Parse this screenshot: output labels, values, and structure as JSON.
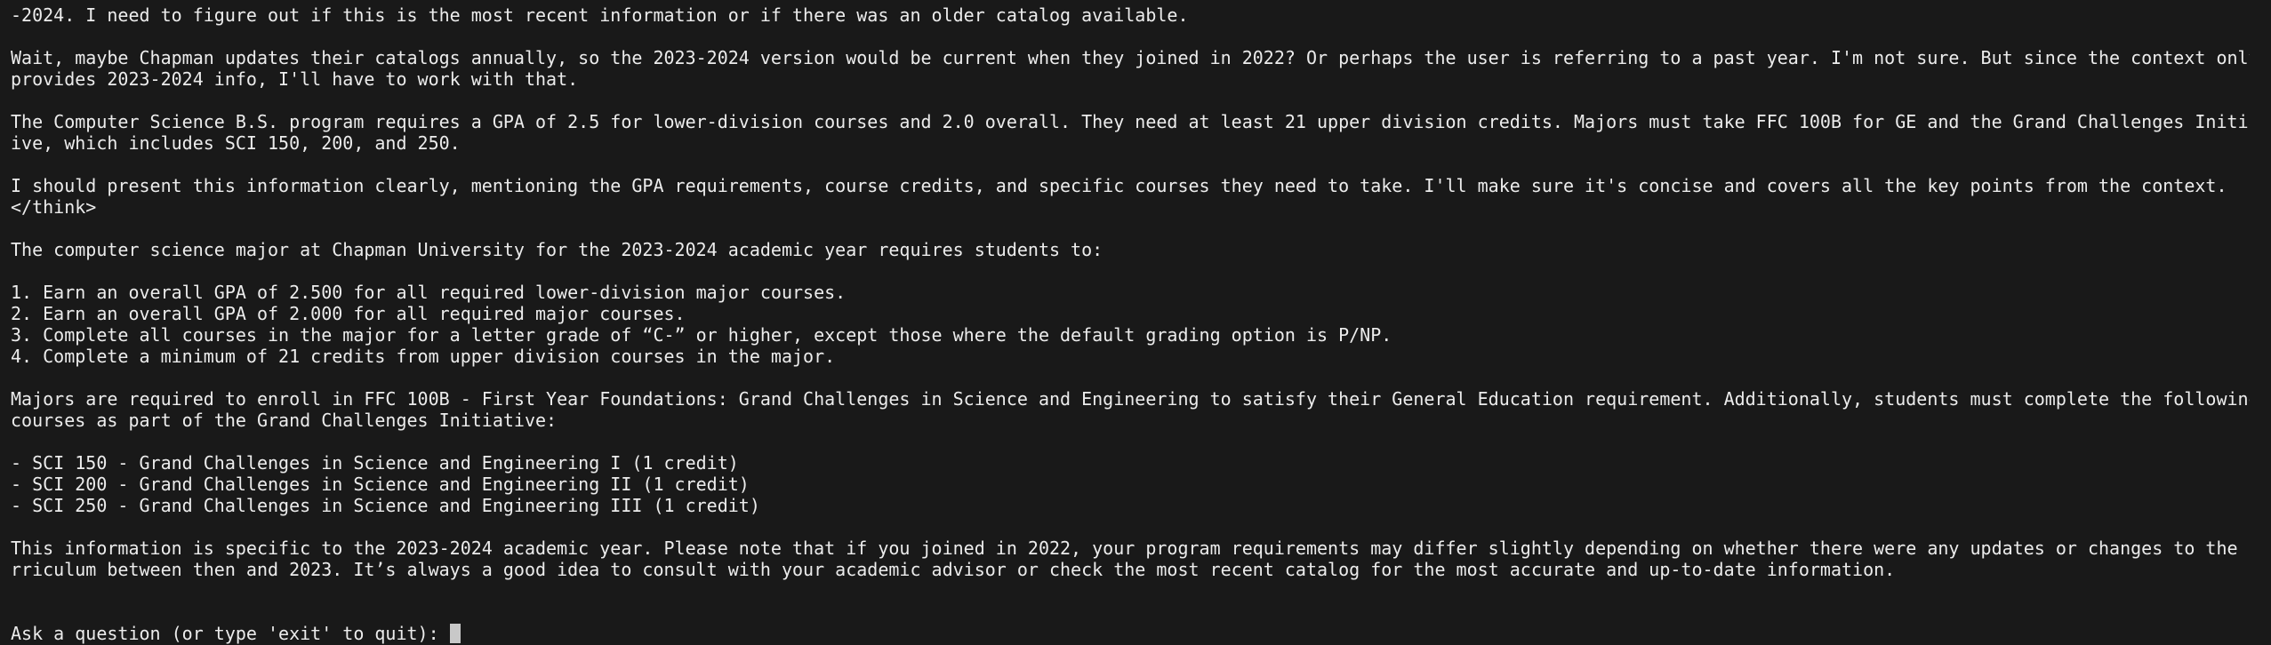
{
  "colors": {
    "background": "#191919",
    "text": "#ececec",
    "cursor": "#c8c8c8"
  },
  "output": {
    "lines": [
      "-2024. I need to figure out if this is the most recent information or if there was an older catalog available.",
      "",
      "Wait, maybe Chapman updates their catalogs annually, so the 2023-2024 version would be current when they joined in 2022? Or perhaps the user is referring to a past year. I'm not sure. But since the context only",
      "provides 2023-2024 info, I'll have to work with that.",
      "",
      "The Computer Science B.S. program requires a GPA of 2.5 for lower-division courses and 2.0 overall. They need at least 21 upper division credits. Majors must take FFC 100B for GE and the Grand Challenges Initiat",
      "ive, which includes SCI 150, 200, and 250.",
      "",
      "I should present this information clearly, mentioning the GPA requirements, course credits, and specific courses they need to take. I'll make sure it's concise and covers all the key points from the context.",
      "</think>",
      "",
      "The computer science major at Chapman University for the 2023-2024 academic year requires students to:",
      "",
      "1. Earn an overall GPA of 2.500 for all required lower-division major courses.",
      "2. Earn an overall GPA of 2.000 for all required major courses.",
      "3. Complete all courses in the major for a letter grade of “C-” or higher, except those where the default grading option is P/NP.",
      "4. Complete a minimum of 21 credits from upper division courses in the major.",
      "",
      "Majors are required to enroll in FFC 100B - First Year Foundations: Grand Challenges in Science and Engineering to satisfy their General Education requirement. Additionally, students must complete the following",
      "courses as part of the Grand Challenges Initiative:",
      "",
      "- SCI 150 - Grand Challenges in Science and Engineering I (1 credit)",
      "- SCI 200 - Grand Challenges in Science and Engineering II (1 credit)",
      "- SCI 250 - Grand Challenges in Science and Engineering III (1 credit)",
      "",
      "This information is specific to the 2023-2024 academic year. Please note that if you joined in 2022, your program requirements may differ slightly depending on whether there were any updates or changes to the cu",
      "rriculum between then and 2023. It’s always a good idea to consult with your academic advisor or check the most recent catalog for the most accurate and up-to-date information."
    ]
  },
  "prompt": {
    "text": "Ask a question (or type 'exit' to quit): "
  }
}
